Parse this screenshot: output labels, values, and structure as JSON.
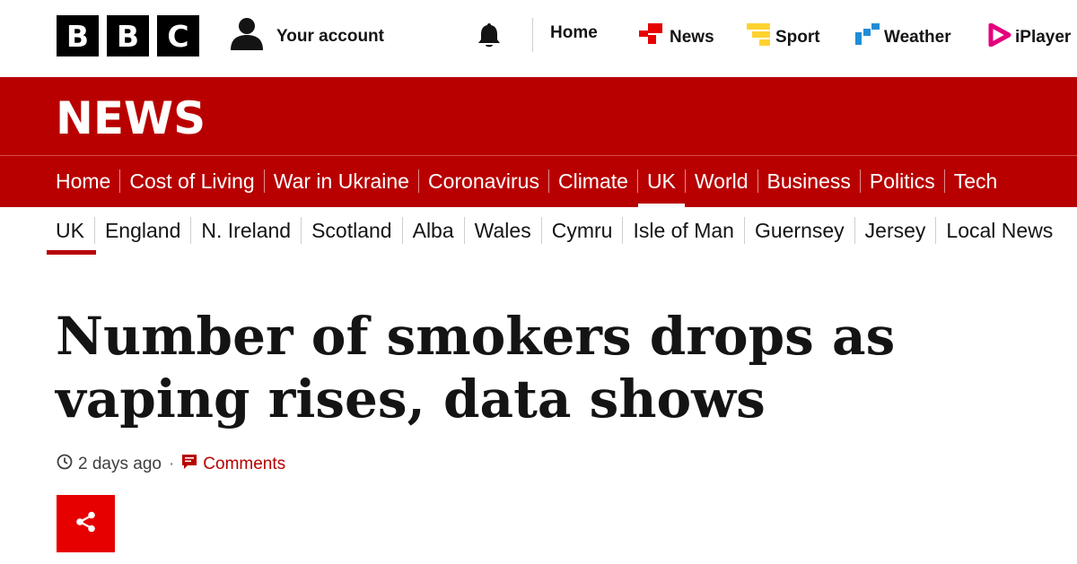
{
  "brand": {
    "letters": [
      "B",
      "B",
      "C"
    ]
  },
  "account": {
    "label": "Your account"
  },
  "topnav": [
    {
      "label": "Home",
      "icon": "none"
    },
    {
      "label": "News",
      "icon": "news-icon"
    },
    {
      "label": "Sport",
      "icon": "sport-icon"
    },
    {
      "label": "Weather",
      "icon": "weather-icon"
    },
    {
      "label": "iPlayer",
      "icon": "iplayer-icon"
    }
  ],
  "banner": {
    "title": "NEWS"
  },
  "primary_nav": [
    "Home",
    "Cost of Living",
    "War in Ukraine",
    "Coronavirus",
    "Climate",
    "UK",
    "World",
    "Business",
    "Politics",
    "Tech"
  ],
  "primary_active": "UK",
  "secondary_nav": [
    "UK",
    "England",
    "N. Ireland",
    "Scotland",
    "Alba",
    "Wales",
    "Cymru",
    "Isle of Man",
    "Guernsey",
    "Jersey",
    "Local News"
  ],
  "secondary_active": "UK",
  "article": {
    "headline": "Number of smokers drops as vaping rises, data shows",
    "time": "2 days ago",
    "separator": "·",
    "comments_label": "Comments"
  },
  "colors": {
    "brand_red": "#b80000",
    "share_red": "#e60000",
    "news_icon": "#e60000",
    "sport_icon": "#ffd230",
    "weather_icon": "#1f8dd6",
    "iplayer_icon": "#e5007d"
  }
}
